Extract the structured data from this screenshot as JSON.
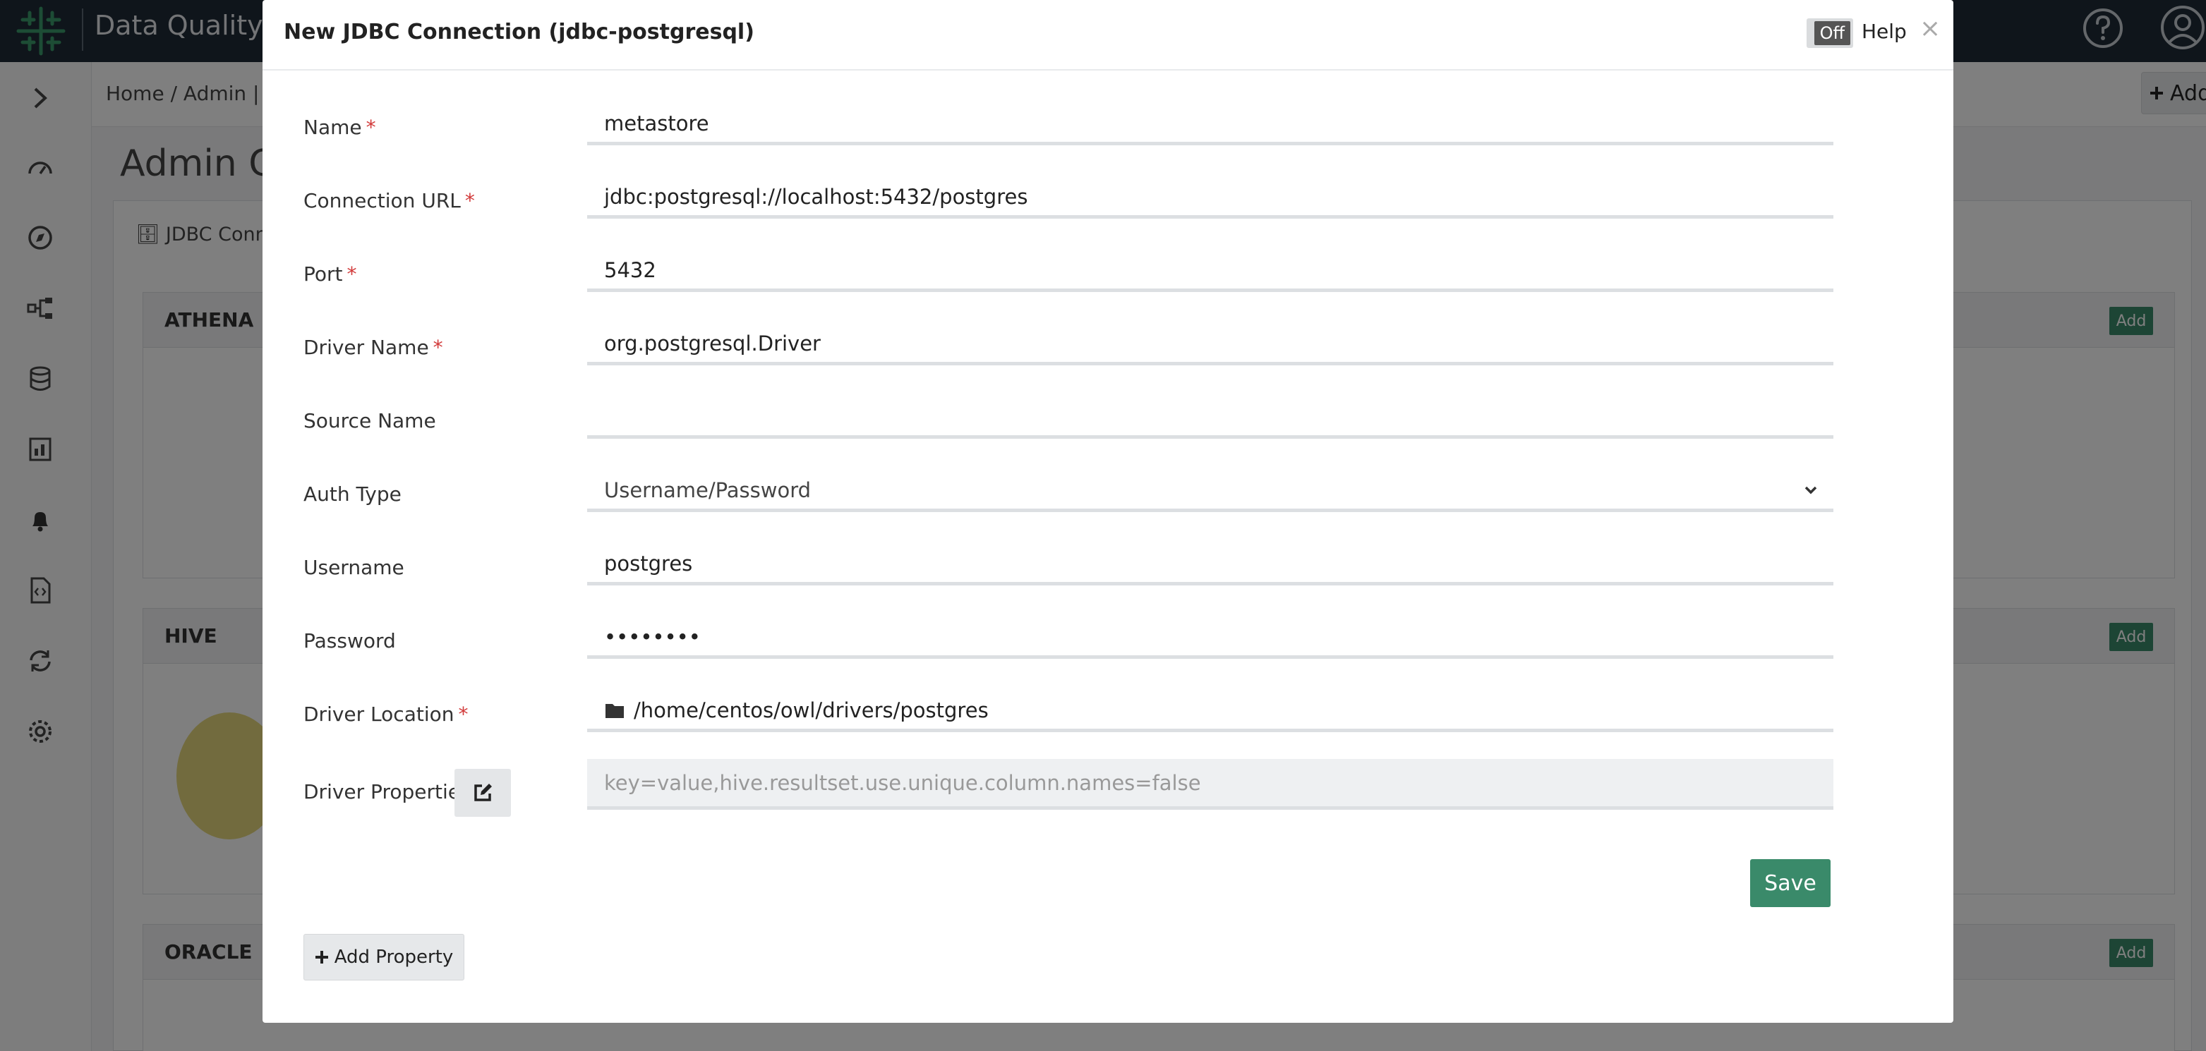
{
  "app": {
    "title": "Data Quality",
    "brand_color": "#1e2a36",
    "accent_color": "#3a8a6a"
  },
  "breadcrumb": "Home  /  Admin  |  C",
  "toolbar": {
    "add_driver_label": "Add Driver",
    "add_driver_icon": "plus-icon"
  },
  "page": {
    "heading": "Admin Co",
    "tab_label": "JDBC Conne"
  },
  "connections": [
    {
      "name": "ATHENA",
      "add_label": "Add"
    },
    {
      "name": "HIVE",
      "add_label": "Add"
    },
    {
      "name": "ORACLE",
      "add_label": "Add"
    }
  ],
  "sidebar_icons": [
    "chevron-right-icon",
    "dashboard-icon",
    "compass-icon",
    "lineage-icon",
    "database-icon",
    "report-icon",
    "bell-icon",
    "file-code-icon",
    "sync-icon",
    "gear-icon"
  ],
  "modal": {
    "title": "New JDBC Connection (jdbc-postgresql)",
    "help_toggle": "Off",
    "help_label": "Help",
    "close_label": "×",
    "fields": {
      "name": {
        "label": "Name",
        "required": "*",
        "value": "metastore"
      },
      "connection_url": {
        "label": "Connection URL",
        "required": "*",
        "value": "jdbc:postgresql://localhost:5432/postgres"
      },
      "port": {
        "label": "Port",
        "required": "*",
        "value": "5432"
      },
      "driver_name": {
        "label": "Driver Name",
        "required": "*",
        "value": "org.postgresql.Driver"
      },
      "source_name": {
        "label": "Source Name",
        "value": ""
      },
      "auth_type": {
        "label": "Auth Type",
        "value": "Username/Password"
      },
      "username": {
        "label": "Username",
        "value": "postgres"
      },
      "password": {
        "label": "Password",
        "value": "••••••••"
      },
      "driver_location": {
        "label": "Driver Location",
        "required": "*",
        "value": "/home/centos/owl/drivers/postgres"
      },
      "driver_properties": {
        "label": "Driver Properties",
        "placeholder": "key=value,hive.resultset.use.unique.column.names=false"
      }
    },
    "save_label": "Save",
    "add_property_label": "Add Property"
  }
}
